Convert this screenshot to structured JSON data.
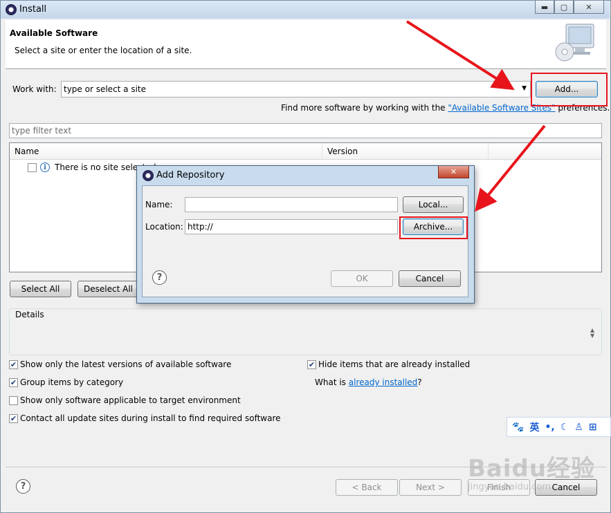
{
  "window": {
    "title": "Install"
  },
  "header": {
    "title": "Available Software",
    "subtitle": "Select a site or enter the location of a site."
  },
  "work_with": {
    "label": "Work with:",
    "placeholder": "type or select a site",
    "add_button": "Add..."
  },
  "find_more": {
    "prefix": "Find more software by working with the ",
    "link": "\"Available Software Sites\"",
    "suffix": " preferences."
  },
  "filter": {
    "placeholder": "type filter text"
  },
  "table": {
    "columns": [
      "Name",
      "Version"
    ],
    "rows": [
      {
        "name": "There is no site selected."
      }
    ]
  },
  "buttons": {
    "select_all": "Select All",
    "deselect_all": "Deselect All"
  },
  "details": {
    "label": "Details"
  },
  "options": {
    "left": [
      {
        "label": "Show only the latest versions of available software",
        "checked": true
      },
      {
        "label": "Group items by category",
        "checked": true
      },
      {
        "label": "Show only software applicable to target environment",
        "checked": false
      },
      {
        "label": "Contact all update sites during install to find required software",
        "checked": true
      }
    ],
    "right": [
      {
        "label": "Hide items that are already installed",
        "checked": true
      }
    ],
    "what_is": {
      "prefix": "What is ",
      "link": "already installed",
      "suffix": "?"
    }
  },
  "footer": {
    "back": "< Back",
    "next": "Next >",
    "finish": "Finish",
    "cancel": "Cancel"
  },
  "dialog": {
    "title": "Add Repository",
    "name_label": "Name:",
    "name_value": "",
    "location_label": "Location:",
    "location_value": "http://",
    "local_button": "Local...",
    "archive_button": "Archive...",
    "ok_button": "OK",
    "cancel_button": "Cancel"
  },
  "ime": {
    "mode": "英"
  },
  "watermark": {
    "text": "Baidu经验",
    "sub": "jingyan.baidu.com"
  },
  "colors": {
    "annotation_red": "#e8141c",
    "link_blue": "#0066cc"
  }
}
